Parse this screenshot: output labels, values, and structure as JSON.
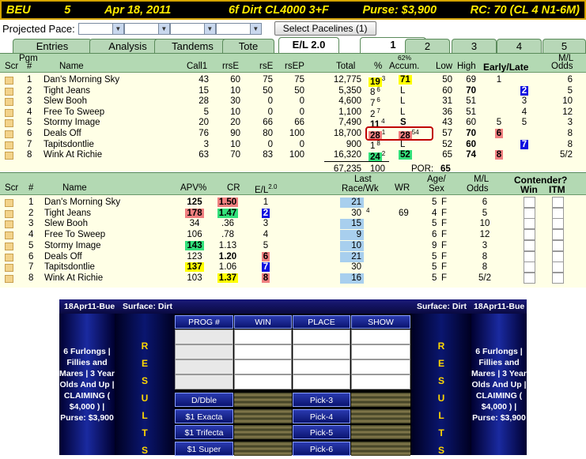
{
  "title": {
    "track": "BEU",
    "race": "5",
    "date": "Apr 18, 2011",
    "conditions": "6f  Dirt  CL4000  3+F",
    "purse": "Purse: $3,900",
    "rc": "RC: 70  (CL 4 N1-6M)"
  },
  "pace": {
    "label": "Projected Pace:",
    "button": "Select Pacelines  (1)"
  },
  "tabs": [
    "Entries",
    "Analysis",
    "Tandems",
    "Tote",
    "E/L 2.0",
    "1",
    "2",
    "3",
    "4",
    "5"
  ],
  "colors": {
    "header_green": "#b3d9b3",
    "panel": "#ffffe6",
    "yellow": "#ffff00",
    "pink": "#f08080",
    "green": "#33e07a",
    "blue": "#1010e0"
  },
  "table1": {
    "headers": {
      "scr": "Scr",
      "pgm": "Pgm",
      "num": "#",
      "name": "Name",
      "call1": "Call1",
      "rrse": "rrsE",
      "rse": "rsE",
      "rsep": "rsEP",
      "total": "Total",
      "pct": "%",
      "accum_top": "62%",
      "accum": "Accum.",
      "low": "Low",
      "high": "High",
      "early_late": "Early/Late",
      "ml_top": "M/L",
      "ml": "Odds"
    },
    "rows": [
      {
        "num": "1",
        "name": "Dan's Morning Sky",
        "call1": "43",
        "rrse": "60",
        "rse": "75",
        "rsep": "75",
        "total": "12,775",
        "pct": "19",
        "pct_sup": "3",
        "accum": "71",
        "low": "50",
        "high": "69",
        "early": "1",
        "late": "",
        "odds": "6"
      },
      {
        "num": "2",
        "name": "Tight Jeans",
        "call1": "15",
        "rrse": "10",
        "rse": "50",
        "rsep": "50",
        "total": "5,350",
        "pct": "8",
        "pct_sup": "6",
        "accum": "L",
        "low": "60",
        "high": "70",
        "early": "",
        "late": "2",
        "odds": "5"
      },
      {
        "num": "3",
        "name": "Slew Booh",
        "call1": "28",
        "rrse": "30",
        "rse": "0",
        "rsep": "0",
        "total": "4,600",
        "pct": "7",
        "pct_sup": "6",
        "accum": "L",
        "low": "31",
        "high": "51",
        "early": "",
        "late": "3",
        "odds": "10"
      },
      {
        "num": "4",
        "name": "Free To Sweep",
        "call1": "5",
        "rrse": "10",
        "rse": "0",
        "rsep": "0",
        "total": "1,100",
        "pct": "2",
        "pct_sup": "7",
        "accum": "L",
        "low": "36",
        "high": "51",
        "early": "",
        "late": "4",
        "odds": "12"
      },
      {
        "num": "5",
        "name": "Stormy Image",
        "call1": "20",
        "rrse": "20",
        "rse": "66",
        "rsep": "66",
        "total": "7,490",
        "pct": "11",
        "pct_sup": "4",
        "accum": "S",
        "low": "43",
        "high": "60",
        "early": "5",
        "late": "5",
        "odds": "3"
      },
      {
        "num": "6",
        "name": "Deals Off",
        "call1": "76",
        "rrse": "90",
        "rse": "80",
        "rsep": "100",
        "total": "18,700",
        "pct": "28",
        "pct_sup": "1",
        "accum": "28",
        "accum_sup": "54",
        "low": "57",
        "high": "70",
        "early": "6",
        "late": "",
        "odds": "8"
      },
      {
        "num": "7",
        "name": "Tapitsdontlie",
        "call1": "3",
        "rrse": "10",
        "rse": "0",
        "rsep": "0",
        "total": "900",
        "pct": "1",
        "pct_sup": "8",
        "accum": "L",
        "low": "52",
        "high": "60",
        "early": "",
        "late": "7",
        "odds": "8"
      },
      {
        "num": "8",
        "name": "Wink At Richie",
        "call1": "63",
        "rrse": "70",
        "rse": "83",
        "rsep": "100",
        "total": "16,320",
        "pct": "24",
        "pct_sup": "2",
        "accum": "52",
        "low": "65",
        "high": "74",
        "early": "8",
        "late": "",
        "odds": "5/2"
      }
    ],
    "totals": {
      "total": "67,235",
      "pct": "100",
      "por_label": "POR:",
      "por": "65"
    }
  },
  "table2": {
    "headers": {
      "scr": "Scr",
      "num": "#",
      "name": "Name",
      "apv": "APV%",
      "cr": "CR",
      "el": "E/L",
      "el_sup": "2.0",
      "last_top": "Last",
      "last": "Race/Wk",
      "wr": "WR",
      "age_top": "Age/",
      "age": "Sex",
      "ml_top": "M/L",
      "ml": "Odds",
      "contender": "Contender?",
      "win": "Win",
      "itm": "ITM"
    },
    "rows": [
      {
        "num": "1",
        "name": "Dan's Morning Sky",
        "apv": "125",
        "cr": "1.50",
        "el": "1",
        "last": "21",
        "wk": "",
        "wr": "",
        "age": "5",
        "sex": "F",
        "odds": "6"
      },
      {
        "num": "2",
        "name": "Tight Jeans",
        "apv": "178",
        "cr": "1.47",
        "el": "2",
        "last": "30",
        "wk": "4",
        "wr": "69",
        "age": "4",
        "sex": "F",
        "odds": "5"
      },
      {
        "num": "3",
        "name": "Slew Booh",
        "apv": "34",
        "cr": ".36",
        "el": "3",
        "last": "15",
        "wk": "",
        "wr": "",
        "age": "5",
        "sex": "F",
        "odds": "10"
      },
      {
        "num": "4",
        "name": "Free To Sweep",
        "apv": "106",
        "cr": ".78",
        "el": "4",
        "last": "9",
        "wk": "",
        "wr": "",
        "age": "6",
        "sex": "F",
        "odds": "12"
      },
      {
        "num": "5",
        "name": "Stormy Image",
        "apv": "143",
        "cr": "1.13",
        "el": "5",
        "last": "10",
        "wk": "",
        "wr": "",
        "age": "9",
        "sex": "F",
        "odds": "3"
      },
      {
        "num": "6",
        "name": "Deals Off",
        "apv": "123",
        "cr": "1.20",
        "el": "6",
        "last": "21",
        "wk": "",
        "wr": "",
        "age": "5",
        "sex": "F",
        "odds": "8"
      },
      {
        "num": "7",
        "name": "Tapitsdontlie",
        "apv": "137",
        "cr": "1.06",
        "el": "7",
        "last": "30",
        "wk": "",
        "wr": "",
        "age": "5",
        "sex": "F",
        "odds": "8"
      },
      {
        "num": "8",
        "name": "Wink At Richie",
        "apv": "103",
        "cr": "1.37",
        "el": "8",
        "last": "16",
        "wk": "",
        "wr": "",
        "age": "5",
        "sex": "F",
        "odds": "5/2"
      }
    ]
  },
  "board": {
    "left_date": "18Apr11-Bue",
    "left_surface": "Surface: Dirt",
    "right_surface": "Surface: Dirt",
    "right_date": "18Apr11-Bue",
    "desc_lines": [
      "6 Furlongs |",
      "Fillies and",
      "Mares | 3 Year",
      "Olds And Up |",
      "CLAIMING (",
      "$4,000 ) |",
      "Purse: $3,900"
    ],
    "results_letters": [
      "R",
      "E",
      "S",
      "U",
      "L",
      "T",
      "S"
    ],
    "cols": [
      "PROG #",
      "WIN",
      "PLACE",
      "SHOW"
    ],
    "bets_left": [
      "D/Dble",
      "$1 Exacta",
      "$1 Trifecta",
      "$1 Super"
    ],
    "bets_right": [
      "Pick-3",
      "Pick-4",
      "Pick-5",
      "Pick-6"
    ]
  }
}
